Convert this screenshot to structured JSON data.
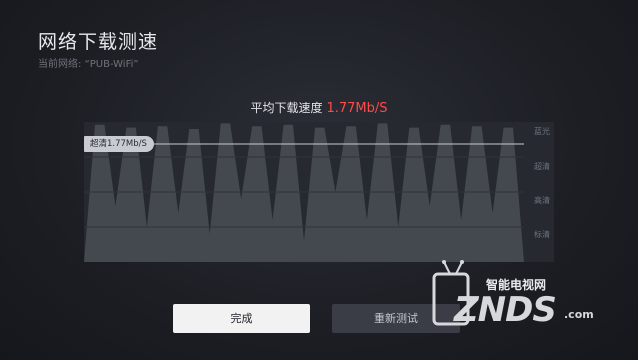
{
  "page": {
    "title": "网络下载测速",
    "current_network": "当前网络: “PUB-WiFi”"
  },
  "speed": {
    "label": "平均下载速度",
    "value": "1.77Mb/S"
  },
  "chart_data": {
    "type": "area",
    "tiers": [
      "蓝光",
      "超清",
      "高清",
      "标清"
    ],
    "marker_label": "超清1.77Mb/S",
    "peaks": [
      0.98,
      0.96,
      0.97,
      0.95,
      0.99,
      0.97,
      0.98,
      0.96,
      0.97,
      0.99,
      0.96,
      0.98,
      0.97,
      0.96
    ],
    "troughs": [
      0.4,
      0.25,
      0.35,
      0.2,
      0.45,
      0.3,
      0.15,
      0.5,
      0.3,
      0.25,
      0.4,
      0.3,
      0.35
    ],
    "colors": {
      "fill": "#4a4d55",
      "line": "#c8cbd1"
    }
  },
  "buttons": {
    "done": "完成",
    "retest": "重新测试"
  },
  "watermark": {
    "cn": "智能电视网",
    "en": "ZNDS",
    "suffix": ".com"
  }
}
